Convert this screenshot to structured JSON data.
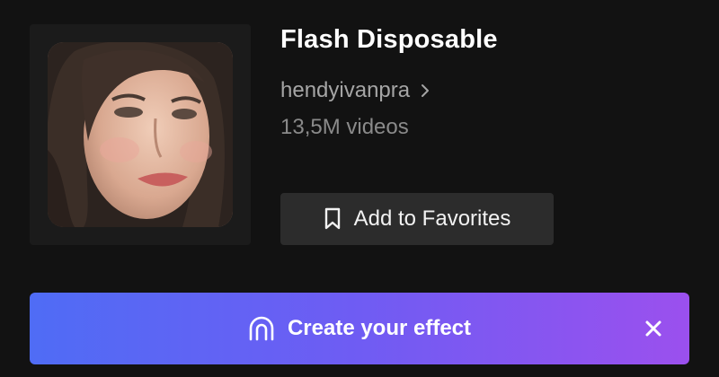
{
  "effect": {
    "title": "Flash Disposable",
    "creator": "hendyivanpra",
    "video_count": "13,5M videos",
    "thumbnail_alt": "effect-preview-portrait"
  },
  "actions": {
    "favorite_label": "Add to Favorites"
  },
  "banner": {
    "label": "Create your effect",
    "gradient_start": "#4f6cf5",
    "gradient_end": "#9b50ee"
  },
  "icons": {
    "creator_chevron": "chevron-right-icon",
    "favorite": "bookmark-icon",
    "banner": "arch-icon",
    "close": "close-icon"
  }
}
